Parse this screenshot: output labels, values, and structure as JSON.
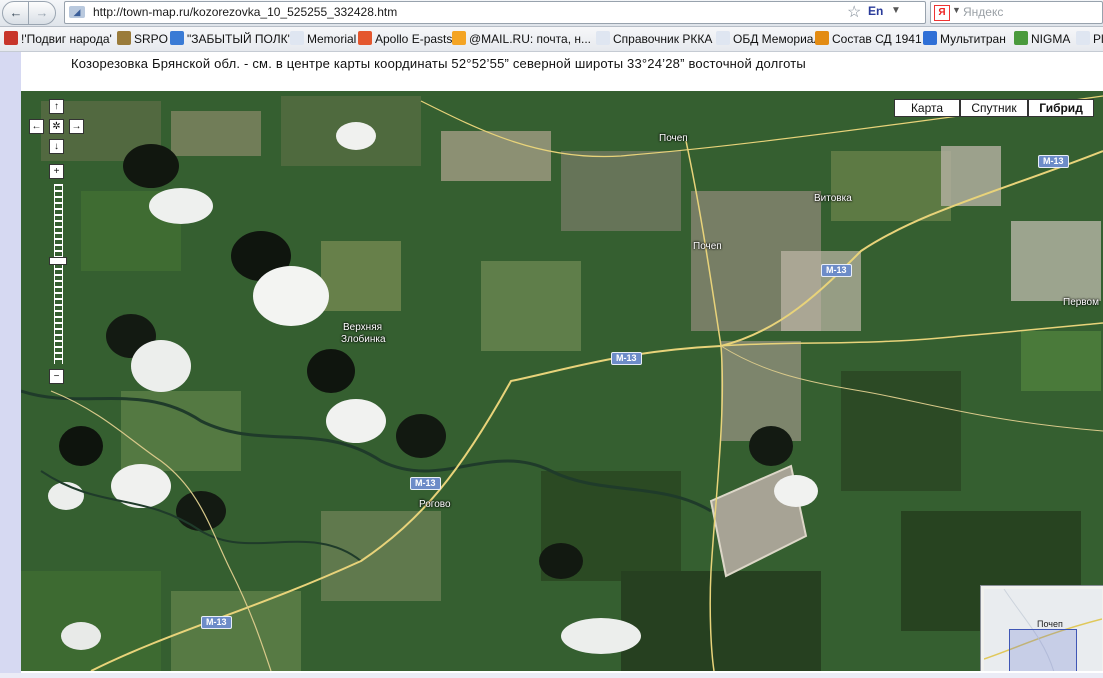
{
  "browser": {
    "url": "http://town-map.ru/kozorezovka_10_525255_332428.htm",
    "lang_indicator": "En",
    "search_placeholder": "Яндекс",
    "back_glyph": "←",
    "forward_glyph": "→",
    "reload_glyph": "C"
  },
  "bookmarks": [
    {
      "label": "!'Подвиг народа'",
      "icon": "red-star-icon",
      "color": "#c8362b"
    },
    {
      "label": "SRPO",
      "icon": "emblem-icon",
      "color": "#9a7b3a"
    },
    {
      "label": "\"ЗАБЫТЫЙ ПОЛК\"",
      "icon": "flag-icon",
      "color": "#3a7bd5"
    },
    {
      "label": "Memorial",
      "icon": "page-icon",
      "color": "#dfe6f1"
    },
    {
      "label": "Apollo E-pasts",
      "icon": "apollo-icon",
      "color": "#e4572e"
    },
    {
      "label": "@MAIL.RU: почта, н...",
      "icon": "mail-ru-icon",
      "color": "#f4a423"
    },
    {
      "label": "Справочник РККА",
      "icon": "page-icon",
      "color": "#dfe6f1"
    },
    {
      "label": "ОБД Мемориал",
      "icon": "page-icon",
      "color": "#dfe6f1"
    },
    {
      "label": "Состав СД 1941",
      "icon": "ribbon-icon",
      "color": "#e38b12"
    },
    {
      "label": "Мультитран",
      "icon": "multitran-icon",
      "color": "#2f6fd6"
    },
    {
      "label": "NIGMA",
      "icon": "nigma-icon",
      "color": "#4a9a3c"
    },
    {
      "label": "Pl",
      "icon": "page-icon",
      "color": "#dfe6f1"
    }
  ],
  "page": {
    "caption": "Козорезовка Брянской обл. - см. в центре карты координаты 52°52’55” северной широты 33°24’28” восточной долготы"
  },
  "map": {
    "type_buttons": {
      "map": "Карта",
      "satellite": "Спутник",
      "hybrid": "Гибрид"
    },
    "selected_type": "Гибрид",
    "nav": {
      "up": "↑",
      "left": "←",
      "center": "✲",
      "right": "→",
      "down": "↓",
      "zoom_in": "+",
      "zoom_out": "−"
    },
    "places": {
      "pochep_n": "Почеп",
      "pochep": "Почеп",
      "vitovka": "Витовка",
      "pervom": "Первом",
      "verkhnyaya_1": "Верхняя",
      "verkhnyaya_2": "Злобинка",
      "rogovo": "Рогово"
    },
    "road_label": "M-13",
    "overview_label": "Почеп",
    "colors": {
      "road": "#e8d37a",
      "shield": "#6d8cc8",
      "overview_rect": "#3f56b5"
    }
  }
}
